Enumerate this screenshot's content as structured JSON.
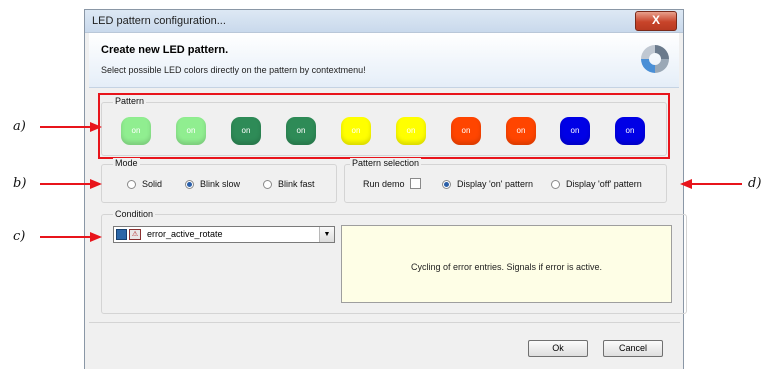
{
  "window": {
    "title": "LED pattern configuration...",
    "close_glyph": "X"
  },
  "header": {
    "title": "Create new LED pattern.",
    "subtitle": "Select possible LED colors directly on the pattern by contextmenu!"
  },
  "pattern": {
    "label": "Pattern",
    "leds": [
      {
        "text": "on",
        "color": "#90ee90"
      },
      {
        "text": "on",
        "color": "#90ee90"
      },
      {
        "text": "on",
        "color": "#2e8b57"
      },
      {
        "text": "on",
        "color": "#2e8b57"
      },
      {
        "text": "on",
        "color": "#ffff00"
      },
      {
        "text": "on",
        "color": "#ffff00"
      },
      {
        "text": "on",
        "color": "#ff4500"
      },
      {
        "text": "on",
        "color": "#ff4500"
      },
      {
        "text": "on",
        "color": "#0000e6"
      },
      {
        "text": "on",
        "color": "#0000e6"
      }
    ]
  },
  "mode": {
    "label": "Mode",
    "options": [
      {
        "label": "Solid",
        "selected": false
      },
      {
        "label": "Blink slow",
        "selected": true
      },
      {
        "label": "Blink fast",
        "selected": false
      }
    ]
  },
  "pattern_selection": {
    "label": "Pattern selection",
    "run_demo_label": "Run demo",
    "run_demo_checked": false,
    "options": [
      {
        "label": "Display 'on' pattern",
        "selected": true
      },
      {
        "label": "Display 'off' pattern",
        "selected": false
      }
    ]
  },
  "condition": {
    "label": "Condition",
    "selected": "error_active_rotate",
    "description": "Cycling of error entries. Signals if error is active."
  },
  "buttons": {
    "ok": "Ok",
    "cancel": "Cancel"
  },
  "annotations": {
    "a": "a)",
    "b": "b)",
    "c": "c)",
    "d": "d)"
  },
  "colors": {
    "highlight": "#e8141b",
    "arrow": "#e8141b"
  }
}
